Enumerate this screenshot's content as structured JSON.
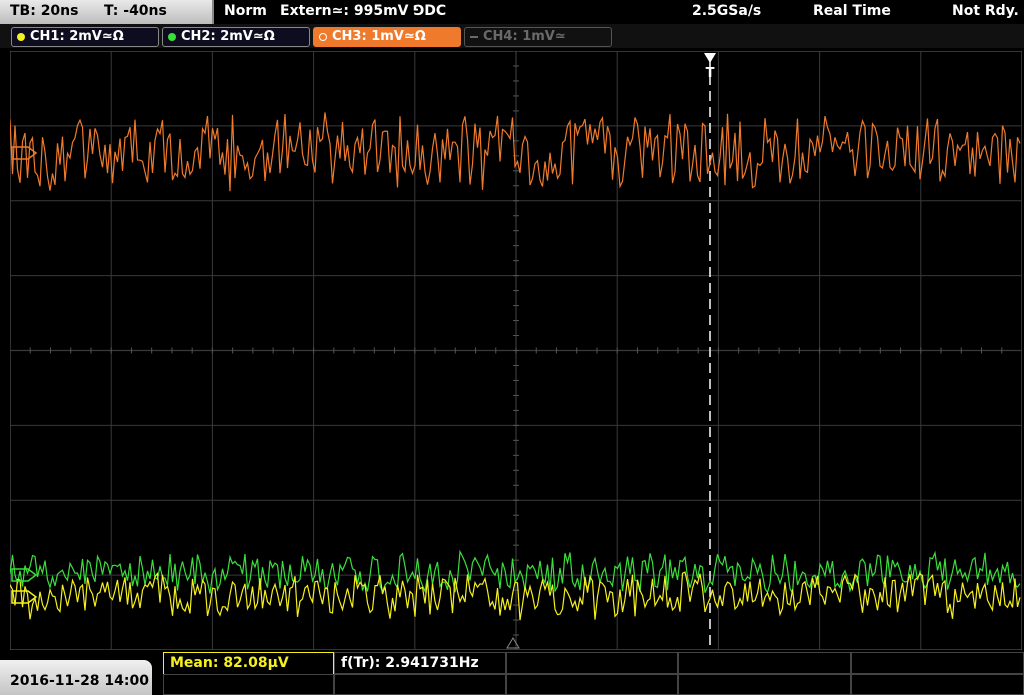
{
  "status_bar": {
    "timebase": "TB: 20ns",
    "trigger_time": "T: -40ns",
    "trigger_mode": "Norm",
    "trigger_source": "Extern≃: 995mV ⅁DC",
    "sample_rate": "2.5GSa/s",
    "acquisition_mode": "Real Time",
    "ready_state": "Not Rdy."
  },
  "channels": [
    {
      "label": "CH1: 2mV≃Ω",
      "color": "#f5f01e",
      "active": true
    },
    {
      "label": "CH2: 2mV≃Ω",
      "color": "#39e03a",
      "active": true
    },
    {
      "label": "CH3: 1mV≃Ω",
      "color": "#f07a2c",
      "active": true,
      "selected": true
    },
    {
      "label": "CH4: 1mV≃",
      "color": "#6a6a6a",
      "active": false
    }
  ],
  "measurements": {
    "mean_label": "Mean: 82.08µV",
    "freq_label": "f(Tr): 2.941731Hz"
  },
  "timestamp": "2016-11-28 14:00",
  "colors": {
    "ch1": "#f5f01e",
    "ch2": "#39e03a",
    "ch3": "#f07a2c",
    "grid": "#3a3a3a",
    "trigger_marker": "#ffffff"
  }
}
